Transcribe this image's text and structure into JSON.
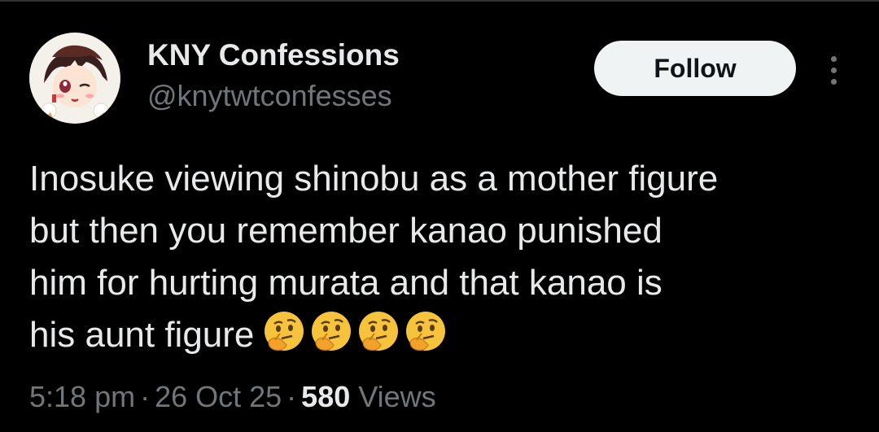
{
  "author": {
    "display_name": "KNY Confessions",
    "handle": "@knytwtconfesses"
  },
  "follow_label": "Follow",
  "tweet": {
    "lines": [
      "Inosuke viewing shinobu as a mother figure",
      "but then you remember kanao punished",
      "him for hurting murata and that kanao is",
      "his aunt figure"
    ],
    "emojis": [
      "thinking-face-emoji",
      "thinking-face-emoji",
      "thinking-face-emoji",
      "thinking-face-emoji"
    ]
  },
  "meta": {
    "time": "5:18 pm",
    "separator": "·",
    "date": "26 Oct 25",
    "views_count": "580",
    "views_label": "Views"
  },
  "colors": {
    "background": "#000000",
    "primary_text": "#e7e9ea",
    "secondary_text": "#71767b",
    "follow_bg": "#eff3f4",
    "follow_text": "#0f1419",
    "emoji_yellow": "#f6c33d"
  }
}
